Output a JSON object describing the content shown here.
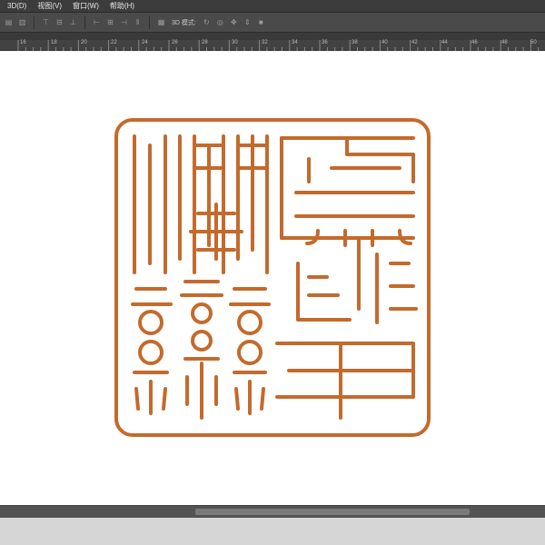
{
  "menu": [
    {
      "label": "3D(D)"
    },
    {
      "label": "视图(V)"
    },
    {
      "label": "窗口(W)"
    },
    {
      "label": "帮助(H)"
    }
  ],
  "options_bar": {
    "mode_label": "3D 模式:"
  },
  "ruler": {
    "labels": [
      "16",
      "18",
      "20",
      "22",
      "24",
      "26",
      "28",
      "30",
      "32",
      "34",
      "36",
      "38",
      "40",
      "42",
      "44",
      "46",
      "48",
      "50"
    ]
  },
  "colors": {
    "seal_stroke": "#c46a2c",
    "canvas_bg": "#ffffff",
    "chrome_bg": "#535353"
  },
  "icons": [
    "move-tool-icon",
    "align-icon",
    "distribute-icon",
    "rotate-3d-icon",
    "roll-3d-icon",
    "drag-3d-icon",
    "slide-3d-icon",
    "scale-3d-icon",
    "video-icon"
  ]
}
